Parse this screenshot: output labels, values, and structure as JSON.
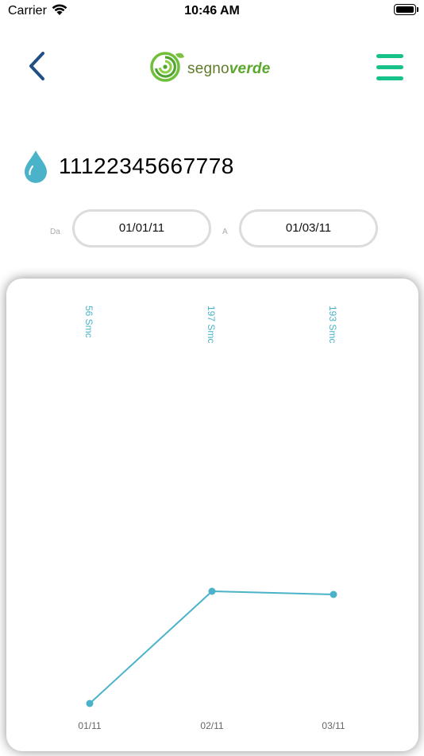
{
  "status_bar": {
    "carrier": "Carrier",
    "time": "10:46 AM"
  },
  "header": {
    "logo_text_part1": "segno",
    "logo_text_part2": "verde",
    "icons": {
      "back": "chevron-left-icon",
      "menu": "hamburger-menu-icon",
      "logo": "spiral-logo-icon"
    }
  },
  "meter": {
    "id": "11122345667778",
    "icon": "water-drop-icon"
  },
  "date_filter": {
    "from_label": "Da",
    "from_value": "01/01/11",
    "to_label": "A",
    "to_value": "01/03/11"
  },
  "colors": {
    "accent": "#4ab3c9",
    "menu": "#16c18a",
    "back": "#1f4f85",
    "logo_green": "#5aa82b"
  },
  "chart_data": {
    "type": "line",
    "categories": [
      "01/11",
      "02/11",
      "03/11"
    ],
    "values": [
      56,
      197,
      193
    ],
    "data_labels": [
      "56 Smc",
      "197 Smc",
      "193 Smc"
    ],
    "ylim": [
      0,
      560
    ],
    "grid": false,
    "legend": "none"
  }
}
